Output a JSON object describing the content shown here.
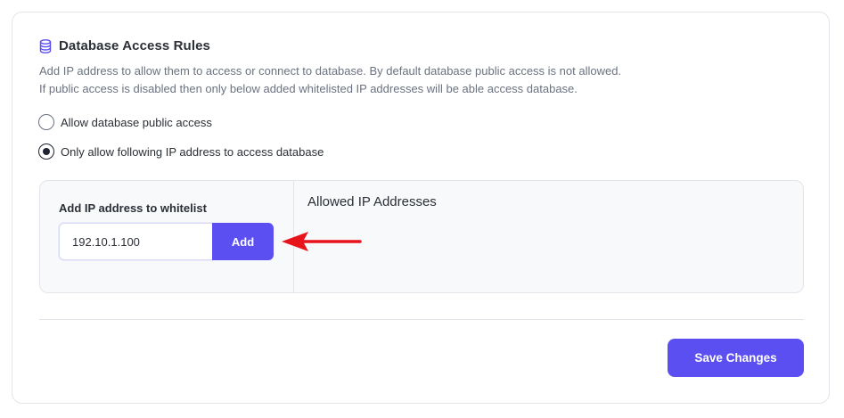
{
  "section": {
    "title": "Database Access Rules",
    "icon": "database-icon",
    "description_line1": "Add IP address to allow them to access or connect to database. By default database public access is not allowed.",
    "description_line2": "If public access is disabled then only below added whitelisted IP addresses will be able access database."
  },
  "access_options": [
    {
      "label": "Allow database public access",
      "selected": false
    },
    {
      "label": "Only allow following IP address to access database",
      "selected": true
    }
  ],
  "whitelist": {
    "label": "Add IP address to whitelist",
    "input_value": "192.10.1.100",
    "add_label": "Add"
  },
  "allowed": {
    "title": "Allowed IP Addresses"
  },
  "footer": {
    "save_label": "Save Changes"
  },
  "colors": {
    "accent": "#5b4ff2",
    "annotation_arrow": "#e8141c"
  }
}
